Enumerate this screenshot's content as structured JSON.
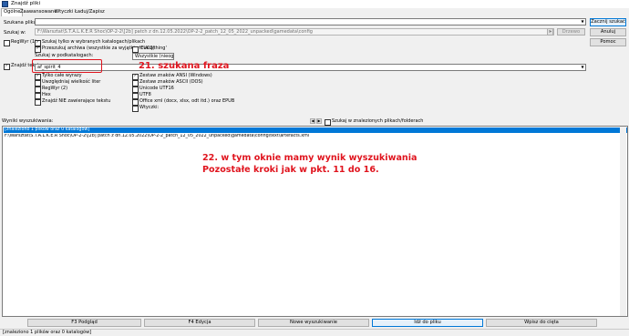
{
  "window": {
    "title": "Znajdź pliki"
  },
  "tabs": [
    "Ogólne",
    "Zaawansowane",
    "Wtyczki",
    "Ładuj/Zapisz"
  ],
  "search_for": {
    "label": "Szukana pliku:",
    "value": ""
  },
  "search_in": {
    "label": "Szukaj w:",
    "value": "F:\\Warsztat\\S.T.A.L.K.E.R Shoc\\OP-2-2\\[2b] patch z dn.12.05.2022\\OP-2-2_patch_12_05_2022_unpacked\\gamedata\\config",
    "button": "Drzewo"
  },
  "regex_name": "RegWyr (1)",
  "options_only_selected": "Szukaj tylko w wybranych katalogach/plikach",
  "options_archives": "Przeszukuj archiwa (wszystkie za wyjątkiem UC2)",
  "options_everything": "'Everything'",
  "subdirs": {
    "label": "Szukaj w podkatalogach:",
    "value": "Wszystkie (nieogr. głęb.)"
  },
  "find_text": {
    "label": "Znajdź tekst:",
    "value": "af_spirit_4"
  },
  "text_opts_left": [
    "Tylko całe wyrazy",
    "Uwzględniaj wielkość liter",
    "RegWyr (2)",
    "Hex",
    "Znajdź NIE zawierające tekstu"
  ],
  "text_opts_left_checked": [
    true,
    false,
    false,
    false,
    false
  ],
  "text_opts_right": [
    "Zestaw znaków ANSI (Windows)",
    "Zestaw znaków ASCII (DOS)",
    "Unicode UTF16",
    "UTF8",
    "Office xml (docx, xlsx, odt itd.) oraz EPUB",
    "Wtyczki:"
  ],
  "text_opts_right_checked": [
    true,
    false,
    false,
    false,
    false,
    false
  ],
  "side_buttons": [
    "Zacznij szukać",
    "Anuluj",
    "Pomoc"
  ],
  "results": {
    "label": "Wyniki wyszukiwania:",
    "search_in_found": "Szukaj w znalezionych plikach/folderach",
    "rows": [
      "[znaleziono 1 plików oraz 0 katalogów]",
      "F:\\Warsztat\\S.T.A.L.K.E.R Shoc\\OP-2-2\\[2b] patch z dn.12.05.2022\\OP-2-2_patch_12_05_2022_unpacked\\gamedata\\config\\text\\artefacts.xml"
    ]
  },
  "annotations": {
    "a21": "21. szukana fraza",
    "a22_line1": "22. w tym oknie mamy wynik wyszukiwania",
    "a22_line2": "Pozostałe kroki jak w pkt. 11 do 16."
  },
  "bottom_buttons": [
    "F3 Podgląd",
    "F4 Edycja",
    "Nowe wyszukiwanie",
    "Idź do pliku",
    "Wpisz do cięta"
  ],
  "status": "[znaleziono 1 plików oraz 0 katalogów]",
  "colors": {
    "annotation": "#e0141e",
    "selection": "#0078d7",
    "highlight_box": "#e0141e"
  }
}
